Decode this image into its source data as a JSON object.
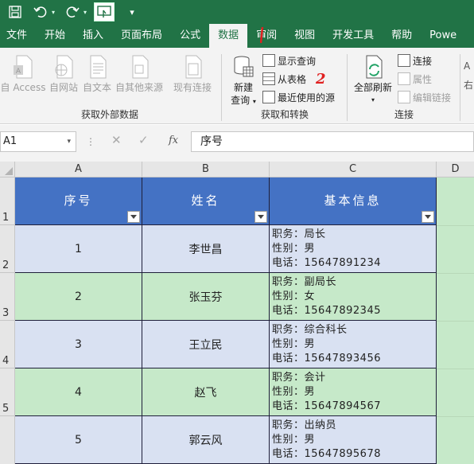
{
  "quick_access": {
    "save_icon": "save-icon",
    "undo_icon": "undo-icon",
    "redo_icon": "redo-icon",
    "touch_icon": "touch-mode-icon",
    "more_icon": "customize-toolbar-icon",
    "more_glyph": "▾"
  },
  "tabs": [
    "文件",
    "开始",
    "插入",
    "页面布局",
    "公式",
    "数据",
    "审阅",
    "视图",
    "开发工具",
    "帮助",
    "Powe"
  ],
  "active_tab": "数据",
  "annotations": {
    "tab_mark": "/",
    "button_mark": "2"
  },
  "ribbon": {
    "external": {
      "label": "获取外部数据",
      "access": "自 Access",
      "web": "自网站",
      "text": "自文本",
      "other": "自其他来源",
      "existing": "现有连接"
    },
    "transform": {
      "label": "获取和转换",
      "new_query_line1": "新建",
      "new_query_line2": "查询",
      "show_queries": "显示查询",
      "from_table": "从表格",
      "recent_sources": "最近使用的源"
    },
    "connections": {
      "label": "连接",
      "refresh_all": "全部刷新",
      "connections": "连接",
      "properties": "属性",
      "edit_links": "编辑链接"
    },
    "extra": {
      "right_cut_1": "A",
      "right_cut_2": "右"
    }
  },
  "formula_bar": {
    "name_box": "A1",
    "cancel_glyph": "✕",
    "enter_glyph": "✓",
    "fx": "fx",
    "formula": "序号"
  },
  "sheet": {
    "columns": [
      "A",
      "B",
      "C",
      "D"
    ],
    "row_numbers": [
      "1",
      "2",
      "3",
      "4",
      "5"
    ],
    "headers": [
      "序号",
      "姓名",
      "基本信息"
    ],
    "rows": [
      {
        "no": "1",
        "name": "李世昌",
        "info": [
          "职务：局长",
          "性别：男",
          "电话：15647891234"
        ]
      },
      {
        "no": "2",
        "name": "张玉芬",
        "info": [
          "职务：副局长",
          "性别：女",
          "电话：15647892345"
        ]
      },
      {
        "no": "3",
        "name": "王立民",
        "info": [
          "职务：综合科长",
          "性别：男",
          "电话：15647893456"
        ]
      },
      {
        "no": "4",
        "name": "赵飞",
        "info": [
          "职务：会计",
          "性别：男",
          "电话：15647894567"
        ]
      },
      {
        "no": "5",
        "name": "郭云风",
        "info": [
          "职务：出纳员",
          "性别：男",
          "电话：15647895678"
        ]
      }
    ]
  }
}
